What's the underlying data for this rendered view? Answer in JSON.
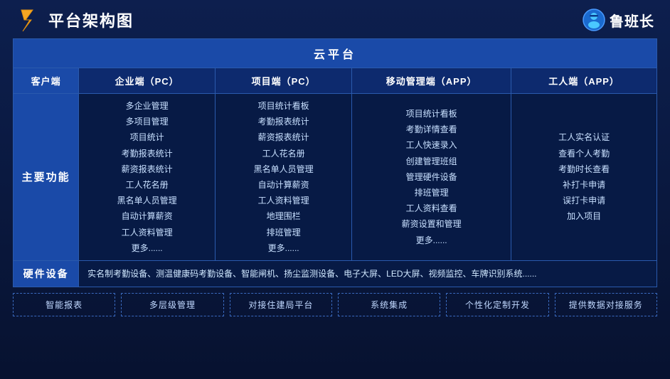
{
  "header": {
    "title": "平台架构图",
    "brand": "鲁班长"
  },
  "cloud": {
    "label": "云平台"
  },
  "columns": {
    "client": "客户端",
    "enterprise": "企业端（PC）",
    "project": "项目端（PC）",
    "mobile": "移动管理端（APP）",
    "worker": "工人端（APP）"
  },
  "main_function_label": "主要功能",
  "enterprise_features": [
    "多企业管理",
    "多项目管理",
    "项目统计",
    "考勤报表统计",
    "薪资报表统计",
    "工人花名册",
    "黑名单人员管理",
    "自动计算薪资",
    "工人资料管理",
    "更多......"
  ],
  "project_features": [
    "项目统计看板",
    "考勤报表统计",
    "薪资报表统计",
    "工人花名册",
    "黑名单人员管理",
    "自动计算薪资",
    "工人资料管理",
    "地理围栏",
    "排班管理",
    "更多......"
  ],
  "mobile_features": [
    "项目统计看板",
    "考勤详情查看",
    "工人快速录入",
    "创建管理班组",
    "管理硬件设备",
    "排班管理",
    "工人资料查看",
    "薪资设置和管理",
    "更多......"
  ],
  "worker_features": [
    "工人实名认证",
    "查看个人考勤",
    "考勤时长查看",
    "补打卡申请",
    "误打卡申请",
    "加入项目"
  ],
  "hardware": {
    "label": "硬件设备",
    "content": "实名制考勤设备、测温健康码考勤设备、智能闸机、扬尘监测设备、电子大屏、LED大屏、视频监控、车牌识别系统......"
  },
  "bottom_items": [
    "智能报表",
    "多层级管理",
    "对接住建局平台",
    "系统集成",
    "个性化定制开发",
    "提供数据对接服务"
  ]
}
